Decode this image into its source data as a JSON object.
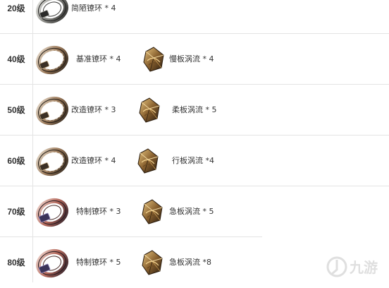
{
  "rows": [
    {
      "level": "20级",
      "ring": "简陋镣环 * 4",
      "gem": ""
    },
    {
      "level": "40级",
      "ring": "基准镣环 * 4",
      "gem": "慢板涡流 * 4"
    },
    {
      "level": "50级",
      "ring": "改造镣环 * 3",
      "gem": "柔板涡流 * 5"
    },
    {
      "level": "60级",
      "ring": "改造镣环 * 4",
      "gem": "行板涡流 *4"
    },
    {
      "level": "70级",
      "ring": "特制镣环 * 3",
      "gem": "急板涡流 * 5"
    },
    {
      "level": "80级",
      "ring": "特制镣环 * 5",
      "gem": "急板涡流 *8"
    }
  ],
  "icons": {
    "ring": "shackle-ring-icon",
    "gem": "vortex-crystal-icon",
    "watermark": "9game-logo"
  },
  "colors": {
    "divider": "#e4e4e4",
    "text": "#333333",
    "ring_metal_gray": "#8d8d88",
    "ring_metal_bronze": "#9c7a5a",
    "ring_metal_red": "#b4675a",
    "gem_dark": "#5b3f1f",
    "gem_gold": "#d3a65b"
  },
  "watermark": {
    "text": "九游"
  }
}
